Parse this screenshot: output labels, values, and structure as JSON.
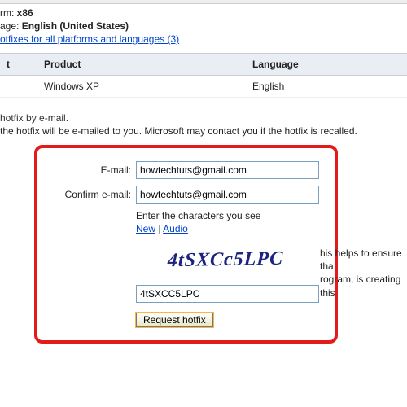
{
  "meta": {
    "platform_label": "rm:",
    "platform_value": "x86",
    "language_label": "age:",
    "language_value": "English (United States)",
    "all_link": "otfixes for all platforms and languages (3)"
  },
  "table": {
    "headers": {
      "select": "t",
      "product": "Product",
      "language": "Language"
    },
    "row": {
      "product": "Windows XP",
      "language": "English"
    }
  },
  "lead": {
    "title": "hotfix by e-mail.",
    "sub": "the hotfix will be e-mailed to you. Microsoft may contact you if the hotfix is recalled."
  },
  "form": {
    "email_label": "E-mail:",
    "email_value": "howtechtuts@gmail.com",
    "confirm_label": "Confirm e-mail:",
    "confirm_value": "howtechtuts@gmail.com",
    "captcha_hint": "Enter the characters you see",
    "captcha_new": "New",
    "captcha_audio": "Audio",
    "captcha_image_text": "4tSXCc5LPC",
    "captcha_input_value": "4tSXCC5LPC",
    "submit_label": "Request hotfix"
  },
  "side_note": {
    "l1": "his helps to ensure tha",
    "l2": "rogram, is creating this"
  }
}
